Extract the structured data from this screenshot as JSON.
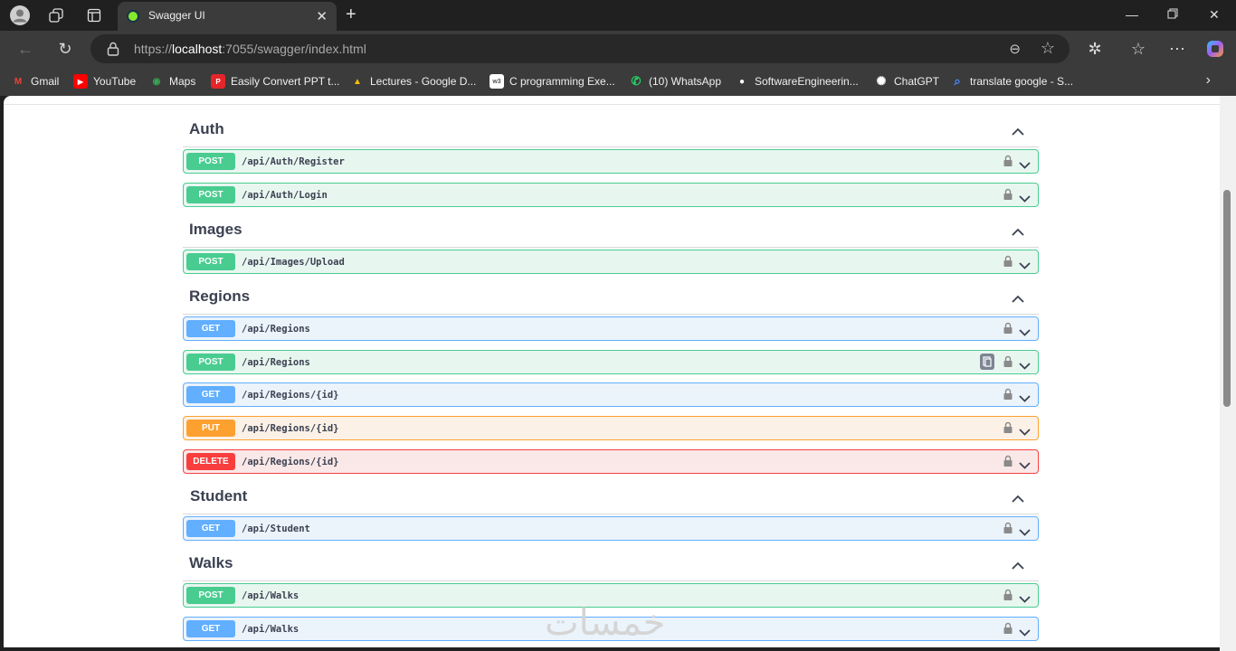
{
  "browser": {
    "tab_title": "Swagger UI",
    "url_prefix": "https://",
    "url_host": "localhost",
    "url_rest": ":7055/swagger/index.html"
  },
  "bookmarks": [
    {
      "label": "Gmail",
      "icon": "gmail-icon",
      "color": "#ea4335",
      "glyph": "M"
    },
    {
      "label": "YouTube",
      "icon": "youtube-icon",
      "color": "#ff0000",
      "glyph": "▶"
    },
    {
      "label": "Maps",
      "icon": "maps-icon",
      "color": "#34a853",
      "glyph": "◉"
    },
    {
      "label": "Easily Convert PPT t...",
      "icon": "pdf-icon",
      "color": "#e5252a",
      "glyph": "P"
    },
    {
      "label": "Lectures - Google D...",
      "icon": "google-drive-icon",
      "color": "#fbbc04",
      "glyph": "▲"
    },
    {
      "label": "C programming Exe...",
      "icon": "w3r-icon",
      "color": "#ffffff",
      "glyph": "w3"
    },
    {
      "label": "(10) WhatsApp",
      "icon": "whatsapp-icon",
      "color": "#25d366",
      "glyph": "✆"
    },
    {
      "label": "SoftwareEngineerin...",
      "icon": "github-icon",
      "color": "#ffffff",
      "glyph": "●"
    },
    {
      "label": "ChatGPT",
      "icon": "chatgpt-icon",
      "color": "#ffffff",
      "glyph": "✺"
    },
    {
      "label": "translate google - S...",
      "icon": "search-icon",
      "color": "#4e8cff",
      "glyph": "⌕"
    }
  ],
  "swagger": {
    "colors": {
      "post": "#49cc90",
      "get": "#61affe",
      "put": "#fca130",
      "delete": "#f93e3e"
    },
    "tags": [
      {
        "name": "Auth",
        "ops": [
          {
            "method": "POST",
            "path": "/api/Auth/Register"
          },
          {
            "method": "POST",
            "path": "/api/Auth/Login"
          }
        ]
      },
      {
        "name": "Images",
        "ops": [
          {
            "method": "POST",
            "path": "/api/Images/Upload"
          }
        ]
      },
      {
        "name": "Regions",
        "ops": [
          {
            "method": "GET",
            "path": "/api/Regions"
          },
          {
            "method": "POST",
            "path": "/api/Regions"
          },
          {
            "method": "GET",
            "path": "/api/Regions/{id}"
          },
          {
            "method": "PUT",
            "path": "/api/Regions/{id}"
          },
          {
            "method": "DELETE",
            "path": "/api/Regions/{id}"
          }
        ]
      },
      {
        "name": "Student",
        "ops": [
          {
            "method": "GET",
            "path": "/api/Student"
          }
        ]
      },
      {
        "name": "Walks",
        "ops": [
          {
            "method": "POST",
            "path": "/api/Walks"
          },
          {
            "method": "GET",
            "path": "/api/Walks"
          }
        ]
      }
    ]
  },
  "watermark": "خمسات"
}
